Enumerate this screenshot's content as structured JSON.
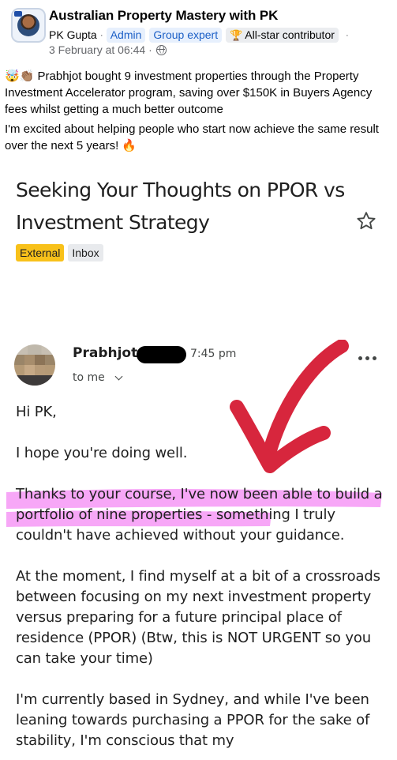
{
  "post": {
    "group_name": "Australian Property Mastery with PK",
    "author": "PK Gupta",
    "separator": "·",
    "badges": {
      "admin": "Admin",
      "group_expert": "Group expert",
      "all_star": "All-star contributor"
    },
    "trailing_separator": "·",
    "date": "3 February at 06:44 ·",
    "paragraph_1_emoji": "🤯👏🏽",
    "paragraph_1": "Prabhjot bought 9 investment properties through the Property Investment Accelerator program, saving over $150K in Buyers Agency fees whilst getting a much better outcome",
    "paragraph_2": "I'm excited about helping people who start now achieve the same result over the next 5 years!",
    "paragraph_2_emoji": "🔥"
  },
  "email": {
    "subject": "Seeking Your Thoughts on PPOR vs Investment Strategy",
    "labels": {
      "external": "External",
      "inbox": "Inbox"
    },
    "sender_name": "Prabhjot",
    "time": "7:45 pm",
    "recipient": "to me",
    "greeting": "Hi PK,",
    "line_1": "I hope you're doing well.",
    "line_2_highlight_a": "Thanks to your course, I've now been able to",
    "line_2_highlight_b": "build a portfolio of nine properties",
    "line_2_rest": " - something I truly couldn't have achieved without your guidance.",
    "line_3": "At the moment, I find myself at a bit of a crossroads between focusing on my next investment property versus preparing for a future principal place of residence (PPOR) (Btw, this is NOT URGENT so you can take your time)",
    "line_4": "I'm currently based in Sydney, and while I've been leaning towards purchasing a PPOR for the sake of stability, I'm conscious that my"
  },
  "colors": {
    "badge_blue": "#1b5fc6",
    "external_label": "#f8c11a",
    "highlight": "#f050f0",
    "arrow": "#d7263d"
  },
  "icons": [
    "group-avatar",
    "trophy-icon",
    "globe-icon",
    "star-icon",
    "more-icon",
    "chevron-down-icon",
    "arrow-annotation"
  ]
}
